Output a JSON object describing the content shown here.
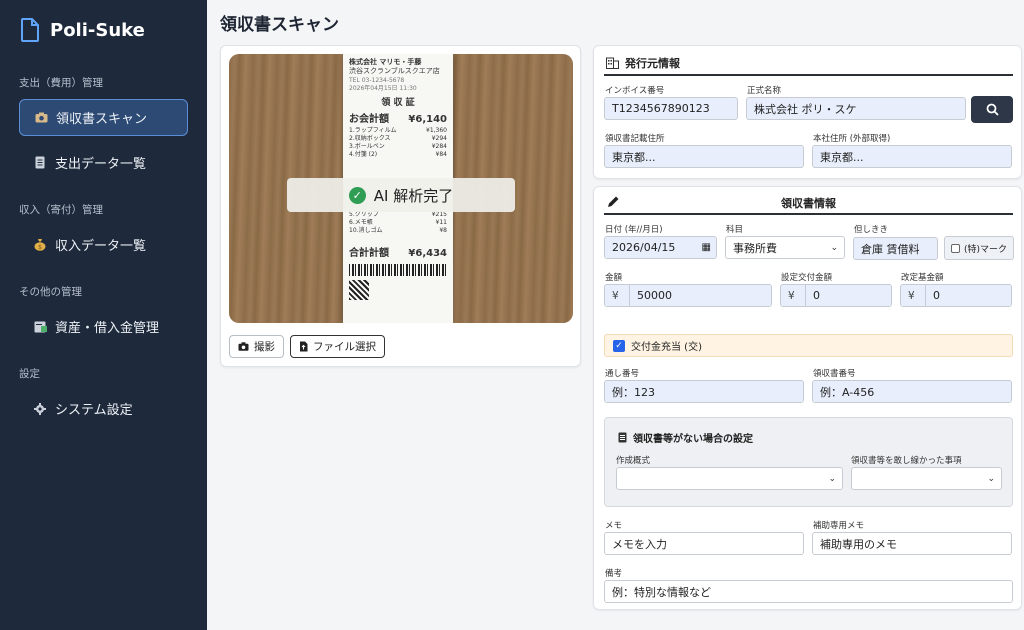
{
  "app": {
    "name": "Poli-Suke"
  },
  "sidebar": {
    "sections": [
      {
        "title": "支出（費用）管理"
      },
      {
        "title": "収入（寄付）管理"
      },
      {
        "title": "その他の管理"
      },
      {
        "title": "設定"
      }
    ],
    "items": [
      {
        "label": "領収書スキャン",
        "icon": "camera-icon",
        "active": true
      },
      {
        "label": "支出データ一覧",
        "icon": "document-icon"
      },
      {
        "label": "収入データ一覧",
        "icon": "money-bag-icon"
      },
      {
        "label": "資産・借入金管理",
        "icon": "ledger-icon"
      },
      {
        "label": "システム設定",
        "icon": "gear-icon"
      }
    ]
  },
  "page": {
    "title": "領収書スキャン"
  },
  "scan": {
    "ai_status": "AI 解析完了",
    "photo_button": "撮影",
    "file_button": "ファイル選択",
    "receipt": {
      "company": "株式会社 マリモ・手藤",
      "store": "渋谷スクランブルスクエア店",
      "title": "領 収 証",
      "total_label": "お会計額",
      "total_value": "¥6,140",
      "paid_label": "合計計額",
      "paid_value": "¥6,434"
    }
  },
  "issuer": {
    "heading": "発行元情報",
    "invoice_label": "インボイス番号",
    "invoice_value": "T1234567890123",
    "official_name_label": "正式名称",
    "official_name_value": "株式会社 ポリ・スケ",
    "address_label": "領収書記載住所",
    "address_value": "東京都...",
    "hq_address_label": "本社住所 (外部取得)",
    "hq_address_value": "東京都..."
  },
  "receipt_info": {
    "heading": "領収書情報",
    "date_label": "日付 (年//月日)",
    "date_value": "2026/04/15",
    "category_label": "科目",
    "category_value": "事務所費",
    "payee_label": "但しきき",
    "payee_value": "倉庫 賃借料",
    "special_mark_label": "(特)マーク",
    "amount_label": "金額",
    "amount_value": "50000",
    "grant_amount_label": "設定交付金額",
    "grant_amount_value": "0",
    "fund_amount_label": "改定基金額",
    "fund_amount_value": "0",
    "currency": "¥",
    "grant_check_label": "交付金充当 (交)",
    "serial_label": "通し番号",
    "serial_placeholder": "例：123",
    "receipt_no_label": "領収書番号",
    "receipt_no_placeholder": "例：A-456",
    "no_receipt_heading": "領収書等がない場合の設定",
    "creation_label": "作成概式",
    "reason_label": "領収書等を敢し線かった事項",
    "memo_label": "メモ",
    "memo_placeholder": "メモを入力",
    "aux_memo_label": "補助専用メモ",
    "aux_memo_placeholder": "補助専用のメモ",
    "remarks_label": "備考",
    "remarks_placeholder": "例：特別な情報など"
  },
  "colors": {
    "sidebar_bg": "#1e293b",
    "active_item_bg": "#2d4a74",
    "field_bg": "#e8eefb",
    "accent": "#2563eb",
    "success": "#2f9e54"
  }
}
